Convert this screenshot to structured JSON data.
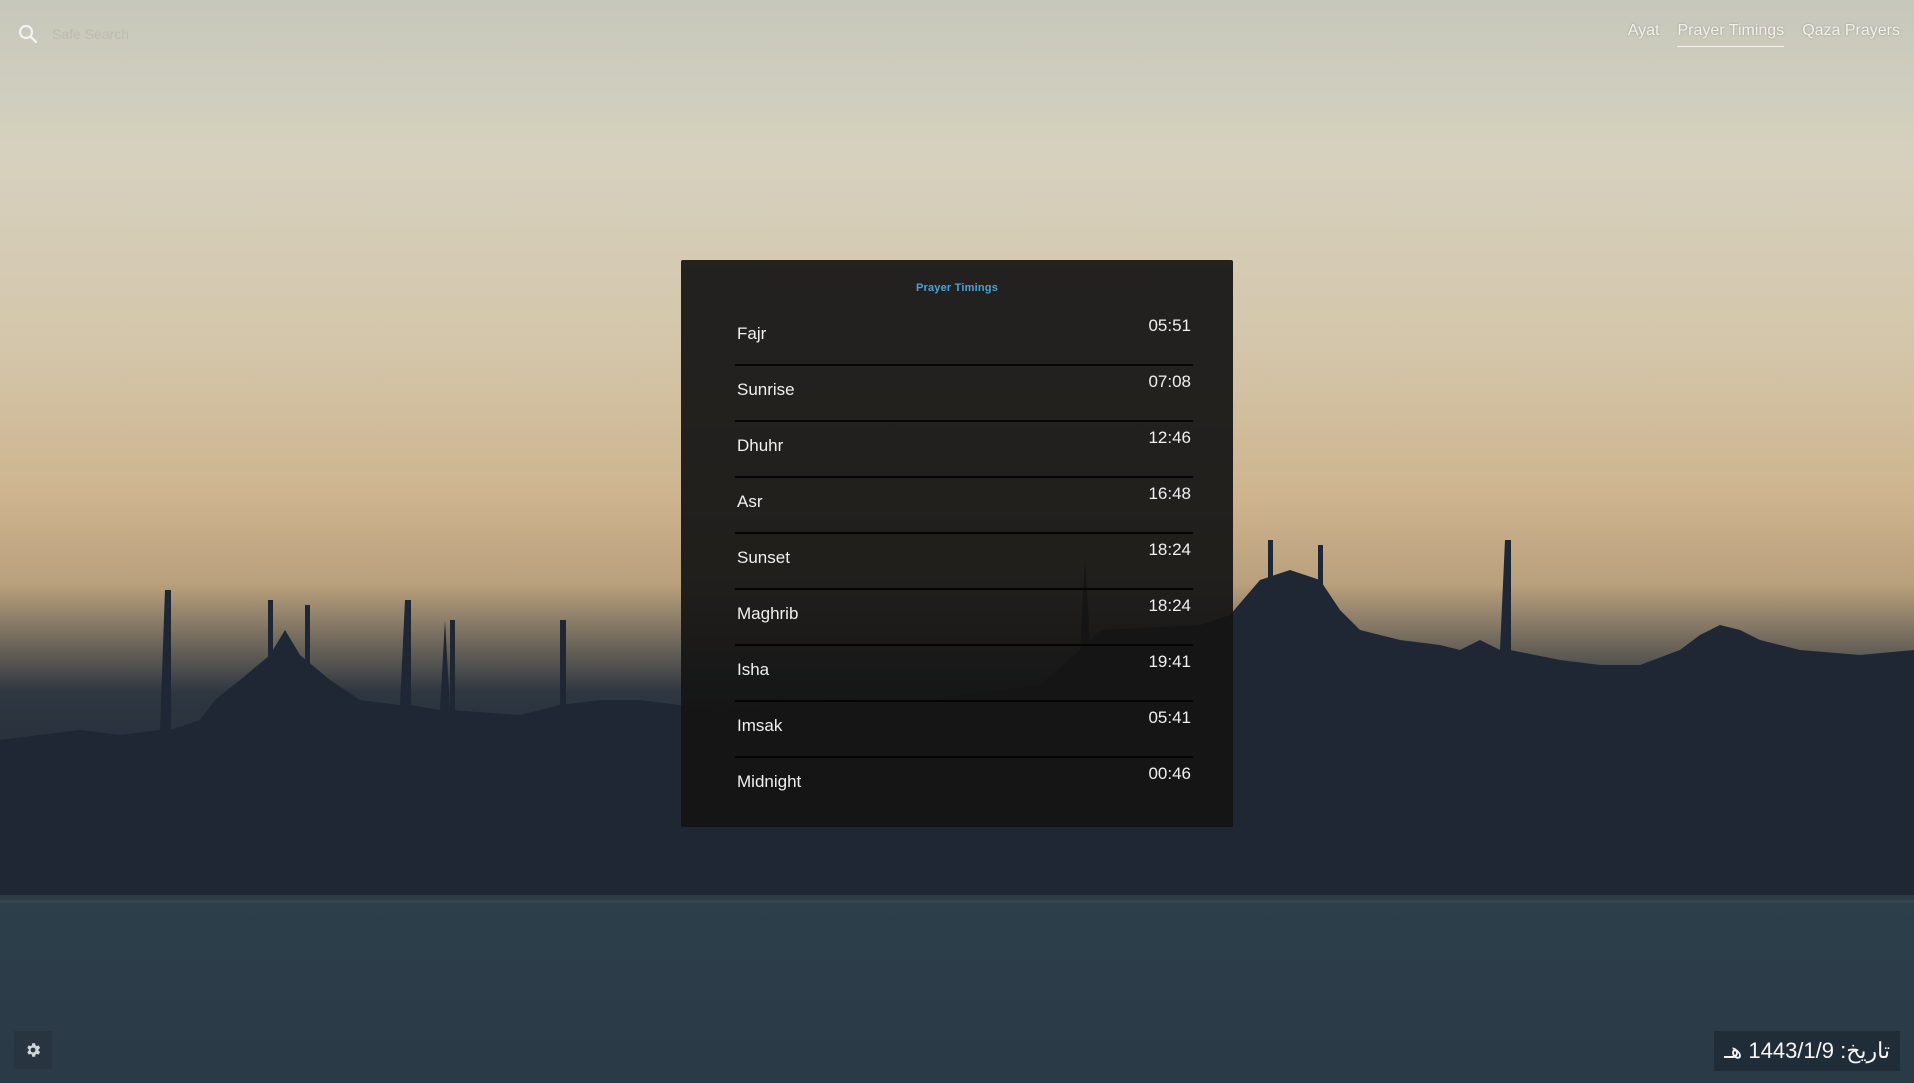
{
  "search": {
    "placeholder": "Safe Search"
  },
  "nav": {
    "items": [
      {
        "label": "Ayat"
      },
      {
        "label": "Prayer Timings"
      },
      {
        "label": "Qaza Prayers"
      }
    ],
    "active": "Prayer Timings"
  },
  "panel": {
    "title": "Prayer Timings",
    "rows": [
      {
        "name": "Fajr",
        "time": "05:51"
      },
      {
        "name": "Sunrise",
        "time": "07:08"
      },
      {
        "name": "Dhuhr",
        "time": "12:46"
      },
      {
        "name": "Asr",
        "time": "16:48"
      },
      {
        "name": "Sunset",
        "time": "18:24"
      },
      {
        "name": "Maghrib",
        "time": "18:24"
      },
      {
        "name": "Isha",
        "time": "19:41"
      },
      {
        "name": "Imsak",
        "time": "05:41"
      },
      {
        "name": "Midnight",
        "time": "00:46"
      }
    ]
  },
  "footer": {
    "date": "تاریخ: 1443/1/9 هـ"
  },
  "colors": {
    "accent": "#4aa3d6",
    "panel_bg": "#141414"
  },
  "icons": {
    "search": "search-icon",
    "settings": "gear-icon"
  }
}
